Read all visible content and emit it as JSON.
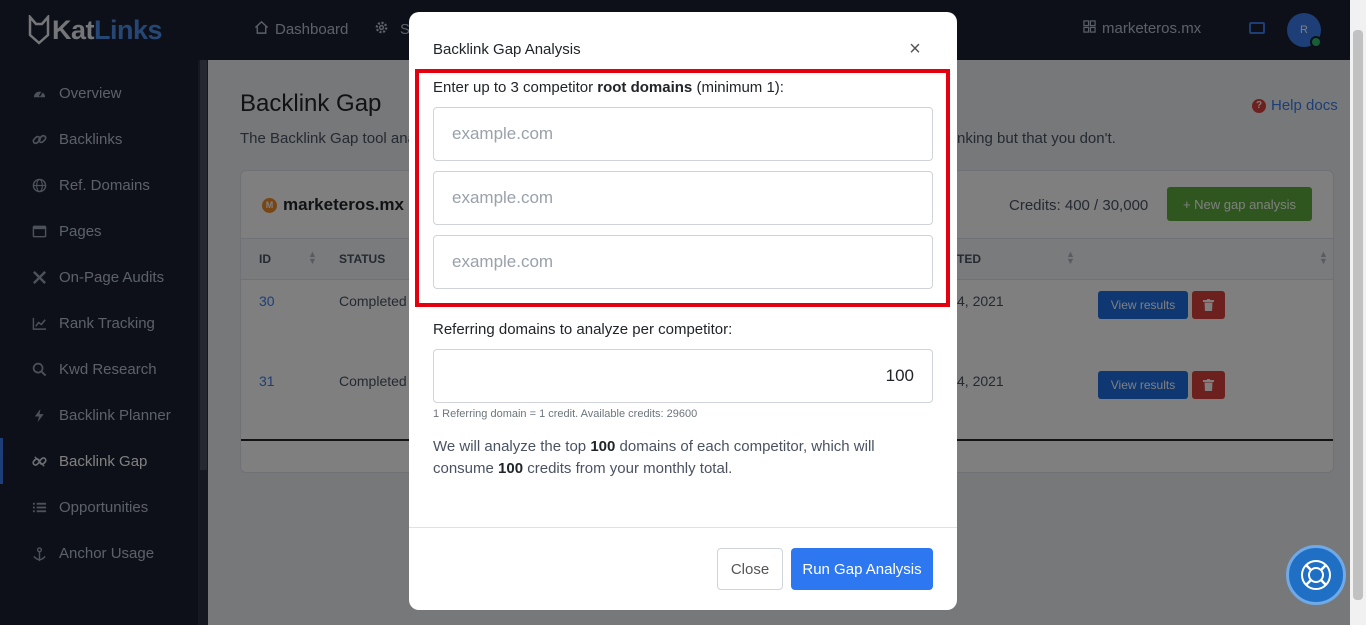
{
  "logo": {
    "part1": "Kat",
    "part2": "Links"
  },
  "sidebar": {
    "items": [
      {
        "label": "Overview",
        "icon": "gauge-icon"
      },
      {
        "label": "Backlinks",
        "icon": "link-icon"
      },
      {
        "label": "Ref. Domains",
        "icon": "globe-icon"
      },
      {
        "label": "Pages",
        "icon": "window-icon"
      },
      {
        "label": "On-Page Audits",
        "icon": "tools-icon"
      },
      {
        "label": "Rank Tracking",
        "icon": "chart-line-icon"
      },
      {
        "label": "Kwd Research",
        "icon": "search-icon"
      },
      {
        "label": "Backlink Planner",
        "icon": "bolt-icon"
      },
      {
        "label": "Backlink Gap",
        "icon": "unlink-icon",
        "active": true
      },
      {
        "label": "Opportunities",
        "icon": "list-icon"
      },
      {
        "label": "Anchor Usage",
        "icon": "anchor-icon"
      }
    ]
  },
  "topbar": {
    "dashboard": "Dashboard",
    "settings_partial": "S",
    "project": "marketeros.mx",
    "avatar_initial": "R"
  },
  "main": {
    "title": "Backlink Gap",
    "description_start": "The Backlink Gap tool ana",
    "description_end": "nking but that you don't.",
    "help": "Help docs",
    "domain": "marketeros.mx",
    "favicon_letter": "M",
    "credits": "Credits: 400 / 30,000",
    "new_button": "+ New gap analysis",
    "columns": {
      "id": "ID",
      "status": "STATUS",
      "created": "TED"
    },
    "rows": [
      {
        "id": "30",
        "status": "Completed",
        "date": "4, 2021",
        "view": "View results"
      },
      {
        "id": "31",
        "status": "Completed",
        "date": "4, 2021",
        "view": "View results"
      }
    ]
  },
  "modal": {
    "title": "Backlink Gap Analysis",
    "close_symbol": "×",
    "label_prefix": "Enter up to 3 competitor ",
    "label_bold": "root domains",
    "label_suffix": " (minimum 1):",
    "competitor_placeholder": "example.com",
    "ref_label": "Referring domains to analyze per competitor:",
    "ref_value": "100",
    "hint": "1 Referring domain = 1 credit. Available credits: 29600",
    "info_a": "We will analyze the top ",
    "info_b": "100",
    "info_c": " domains of each competitor, which will consume ",
    "info_d": "100",
    "info_e": " credits from your monthly total.",
    "close_button": "Close",
    "run_button": "Run Gap Analysis"
  },
  "colors": {
    "sidebar_bg": "#1b2130",
    "accent": "#3b7ded",
    "highlight": "#e4000f",
    "success": "#5cac3d",
    "danger": "#d9433c"
  }
}
